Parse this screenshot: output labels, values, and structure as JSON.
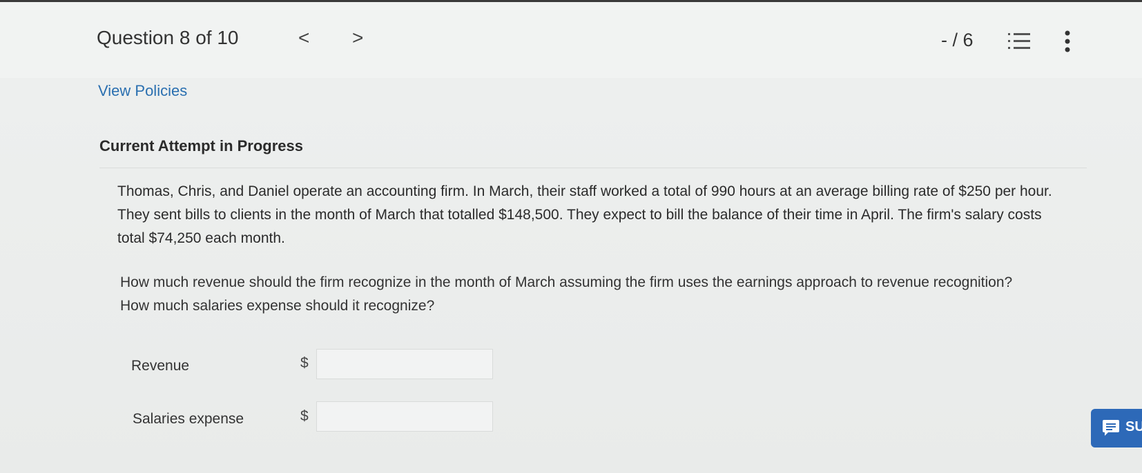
{
  "header": {
    "question_title": "Question 8 of 10",
    "prev_symbol": "<",
    "next_symbol": ">",
    "score": "- / 6",
    "list_icon": "list-icon",
    "more_icon": "more-vertical-icon"
  },
  "links": {
    "view_policies": "View Policies"
  },
  "attempt_status": "Current Attempt in Progress",
  "problem_text": "Thomas, Chris, and Daniel operate an accounting firm. In March, their staff worked a total of 990 hours at an average billing rate of $250 per hour. They sent bills to clients in the month of March that totalled $148,500. They expect to bill the balance of their time in April. The firm's salary costs total $74,250 each month.",
  "question_text": "How much revenue should the firm recognize in the month of March assuming the firm uses the earnings approach to revenue recognition? How much salaries expense should it recognize?",
  "answers": {
    "revenue_label": "Revenue",
    "revenue_currency": "$",
    "revenue_value": "",
    "salaries_label": "Salaries expense",
    "salaries_currency": "$",
    "salaries_value": ""
  },
  "submit": {
    "label": "SU",
    "icon": "message-icon",
    "color": "#2d69b8"
  }
}
